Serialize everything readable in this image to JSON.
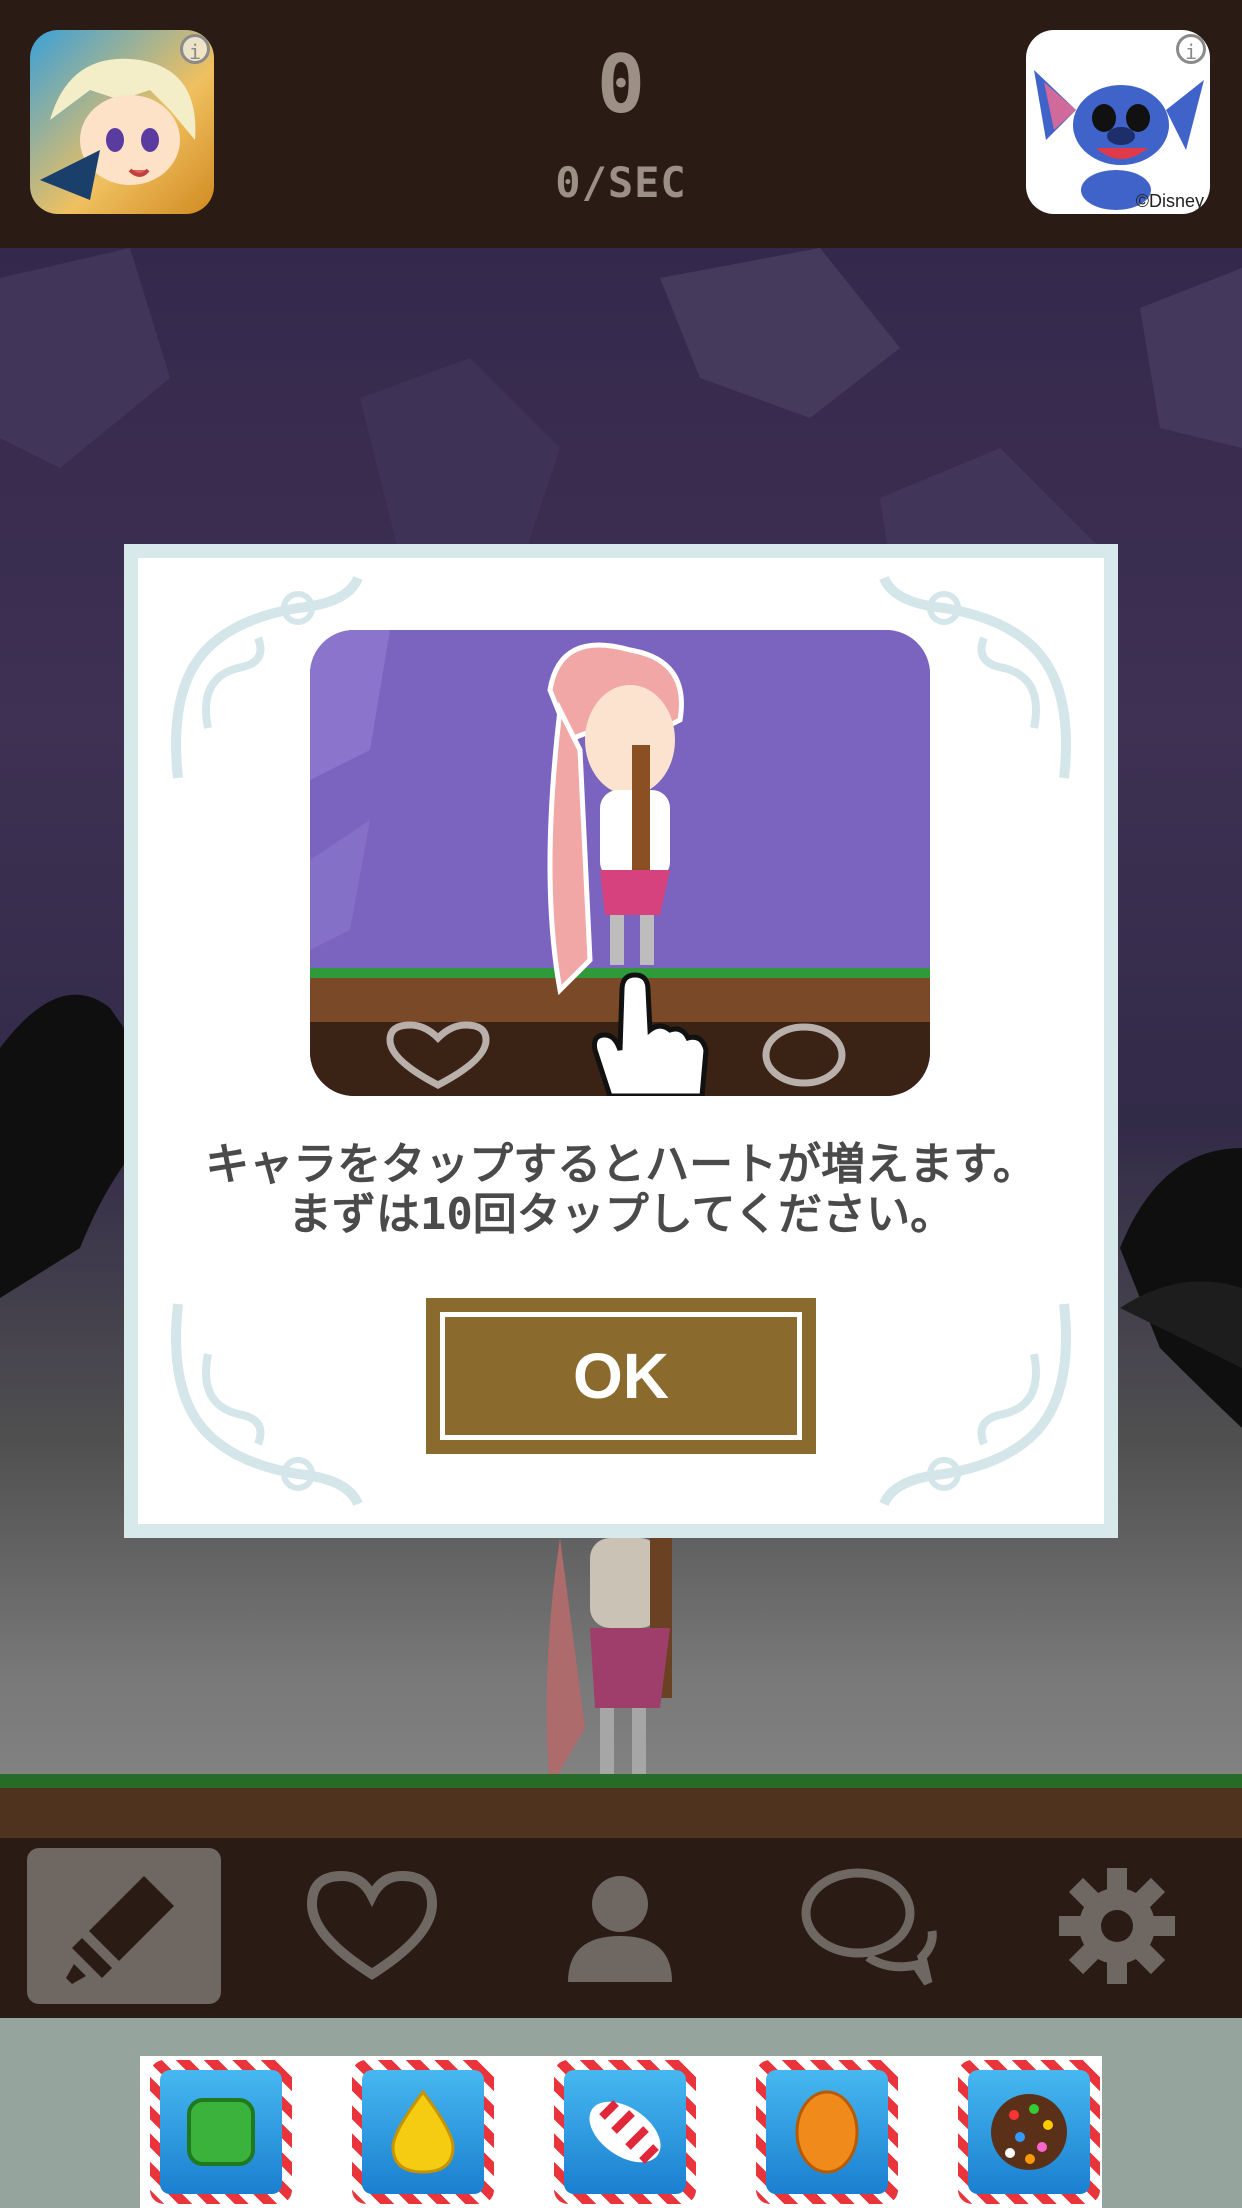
{
  "header": {
    "score": "0",
    "rate": "0/SEC",
    "left_ad": {
      "icon": "anime-hero-app-icon",
      "info_icon": "i"
    },
    "right_ad": {
      "icon": "stitch-app-icon",
      "info_icon": "i",
      "caption": "©Disney"
    }
  },
  "dialog": {
    "message_line1": "キャラをタップするとハートが増えます。",
    "message_line2": "まずは10回タップしてください。",
    "ok_label": "OK"
  },
  "navbar": {
    "items": [
      {
        "icon": "sword-icon",
        "active": true
      },
      {
        "icon": "heart-icon",
        "active": false
      },
      {
        "icon": "person-icon",
        "active": false
      },
      {
        "icon": "chat-icon",
        "active": false
      },
      {
        "icon": "gear-icon",
        "active": false
      }
    ]
  },
  "ad_banner": {
    "items": [
      "green-candy",
      "yellow-drop-candy",
      "striped-candy",
      "orange-candy",
      "color-bomb-candy"
    ]
  },
  "colors": {
    "bar_bg": "#2a1c15",
    "ok_button": "#8b6a2e",
    "dialog_border": "#d8e9ec",
    "tutorial_bg": "#7b63c0"
  }
}
